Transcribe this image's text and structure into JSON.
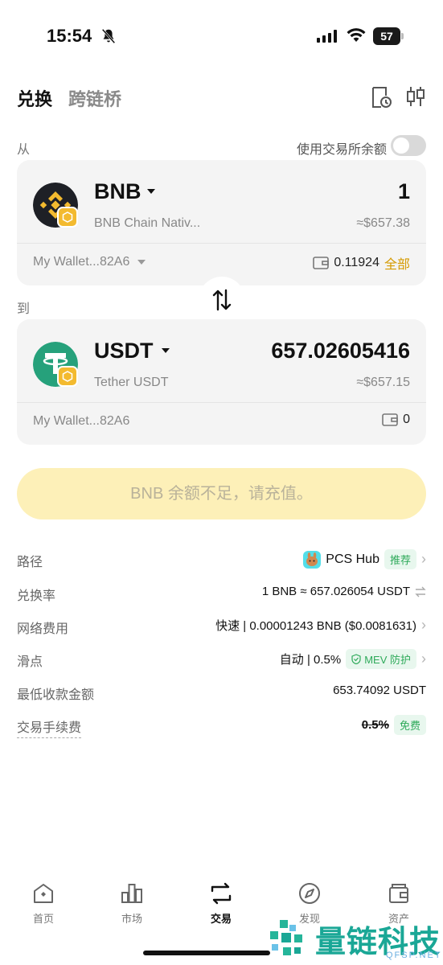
{
  "status_bar": {
    "time": "15:54",
    "battery": "57"
  },
  "header": {
    "tabs": [
      {
        "label": "兑换",
        "active": true
      },
      {
        "label": "跨链桥",
        "active": false
      }
    ]
  },
  "from": {
    "label": "从",
    "use_balance_label": "使用交易所余额",
    "token_symbol": "BNB",
    "token_name": "BNB Chain Nativ...",
    "amount": "1",
    "usd_value": "≈$657.38",
    "wallet": "My Wallet...82A6",
    "wallet_balance": "0.11924",
    "max_label": "全部"
  },
  "to": {
    "label": "到",
    "token_symbol": "USDT",
    "token_name": "Tether USDT",
    "amount": "657.02605416",
    "usd_value": "≈$657.15",
    "wallet": "My Wallet...82A6",
    "wallet_balance": "0"
  },
  "cta": {
    "label": "BNB 余额不足，请充值。"
  },
  "details": {
    "route": {
      "label": "路径",
      "value": "PCS Hub",
      "badge": "推荐"
    },
    "rate": {
      "label": "兑换率",
      "value": "1 BNB ≈ 657.026054 USDT"
    },
    "network_fee": {
      "label": "网络费用",
      "value": "快速 | 0.00001243 BNB ($0.0081631)"
    },
    "slippage": {
      "label": "滑点",
      "value": "自动 | 0.5%",
      "badge": "MEV 防护"
    },
    "min_received": {
      "label": "最低收款金额",
      "value": "653.74092 USDT"
    },
    "trade_fee": {
      "label": "交易手续费",
      "old_value": "0.5%",
      "badge": "免费"
    }
  },
  "nav": {
    "items": [
      {
        "label": "首页"
      },
      {
        "label": "市场"
      },
      {
        "label": "交易"
      },
      {
        "label": "发现"
      },
      {
        "label": "资产"
      }
    ]
  },
  "watermark": {
    "text": "量链科技",
    "sub": "QFSP.NET"
  },
  "colors": {
    "accent": "#f3ba2f",
    "cta_bg": "#fdf0b8",
    "green": "#2eaa5a",
    "tether": "#26a17b"
  }
}
